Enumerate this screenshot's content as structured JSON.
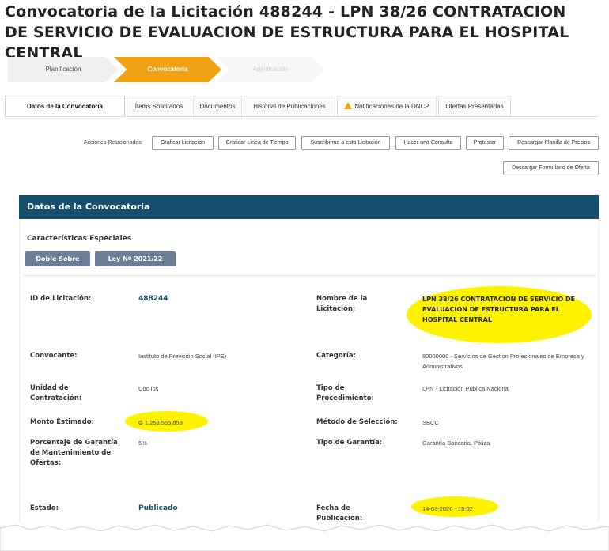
{
  "title": "Convocatoria de la Licitación 488244 - LPN 38/26 CONTRATACION DE SERVICIO DE EVALUACION DE ESTRUCTURA PARA EL HOSPITAL CENTRAL",
  "wizard": {
    "step1": "Planificación",
    "step2": "Convocatoria",
    "step3": "Adjudicación"
  },
  "tabs": {
    "t1": "Datos de la Convocatoria",
    "t2": "Ítems Solicitados",
    "t3": "Documentos",
    "t4": "Historial de Publicaciones",
    "t5": "Notificaciones de la DNCP",
    "t6": "Ofertas Presentadas"
  },
  "actions": {
    "label": "Acciones Relacionadas:",
    "b1": "Graficar Licitación",
    "b2": "Graficar Línea de Tiempo",
    "b3": "Suscribirme a esta Licitación",
    "b4": "Hacer una Consulta",
    "b5": "Protestar",
    "b6": "Descargar Planilla de Precios",
    "b7": "Descargar Formulario de Oferta"
  },
  "panel": {
    "header": "Datos de la Convocatoria",
    "characteristics_title": "Características Especiales",
    "badge1": "Doble Sobre",
    "badge2": "Ley Nº 2021/22"
  },
  "fields": {
    "id_label": "ID de Licitación:",
    "id_value": "488244",
    "nombre_label": "Nombre de la Licitación:",
    "nombre_value": "LPN 38/26 CONTRATACION DE SERVICIO DE EVALUACION DE ESTRUCTURA PARA EL HOSPITAL CENTRAL",
    "convocante_label": "Convocante:",
    "convocante_value": "Instituto de Previsión Social (IPS)",
    "categoria_label": "Categoría:",
    "categoria_value": "80000000 - Servicios de Gestion Profesionales de Empresa y Administrativos",
    "unidad_label": "Unidad de Contratación:",
    "unidad_value": "Uoc Ips",
    "tipo_proc_label": "Tipo de Procedimiento:",
    "tipo_proc_value": "LPN - Licitación Pública Nacional",
    "monto_label": "Monto Estimado:",
    "monto_value": "₲ 1.258.565.858",
    "metodo_label": "Método de Selección:",
    "metodo_value": "SBCC",
    "porcentaje_label": "Porcentaje de Garantía de Mantenimiento de Ofertas:",
    "porcentaje_value": "5%",
    "tipo_garantia_label": "Tipo de Garantía:",
    "tipo_garantia_value": "Garantía Bancaria, Póliza",
    "estado_label": "Estado:",
    "estado_value": "Publicado",
    "fecha_label": "Fecha de Publicación:",
    "fecha_value": "14-03-2026 - 15:02"
  },
  "colors": {
    "accent": "#f1a114",
    "header_bg": "#16506e",
    "highlight": "#fff200",
    "badge": "#6b7f99"
  }
}
